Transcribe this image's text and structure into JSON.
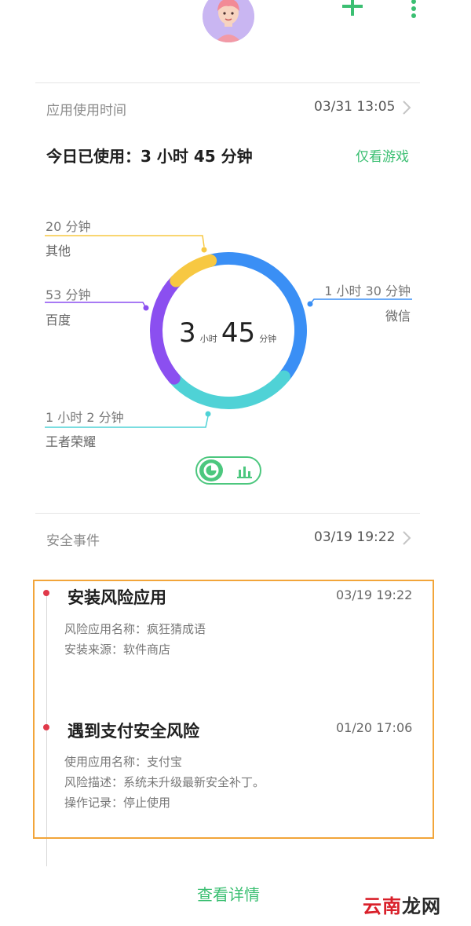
{
  "header": {
    "add_icon": "plus-icon",
    "menu_icon": "more-vertical-icon",
    "accent": "#3bbf72"
  },
  "usage": {
    "title": "应用使用时间",
    "timestamp": "03/31 13:05",
    "total_label": "今日已使用：3 小时 45 分钟",
    "games_only": "仅看游戏",
    "center": {
      "hours": "3",
      "hours_unit": "小时",
      "minutes": "45",
      "minutes_unit": "分钟"
    },
    "apps": [
      {
        "name": "微信",
        "duration": "1 小时 30 分钟",
        "minutes": 90,
        "color": "#3a8ff5"
      },
      {
        "name": "王者荣耀",
        "duration": "1 小时 2 分钟",
        "minutes": 62,
        "color": "#4fd2d6"
      },
      {
        "name": "百度",
        "duration": "53 分钟",
        "minutes": 53,
        "color": "#8b4ff0"
      },
      {
        "name": "其他",
        "duration": "20 分钟",
        "minutes": 20,
        "color": "#f7c842"
      }
    ],
    "toggle": {
      "pie_icon": "pie-chart-icon",
      "bar_icon": "bar-chart-icon"
    }
  },
  "security": {
    "title": "安全事件",
    "timestamp": "03/19 19:22",
    "events": [
      {
        "title": "安装风险应用",
        "time": "03/19 19:22",
        "lines": [
          "风险应用名称：疯狂猜成语",
          "安装来源：软件商店"
        ]
      },
      {
        "title": "遇到支付安全风险",
        "time": "01/20 17:06",
        "lines": [
          "使用应用名称：支付宝",
          "风险描述：系统未升级最新安全补丁。",
          "操作记录：停止使用"
        ]
      }
    ]
  },
  "footer": {
    "details": "查看详情"
  },
  "watermark": {
    "part1": "云南",
    "part2": "龙网"
  }
}
